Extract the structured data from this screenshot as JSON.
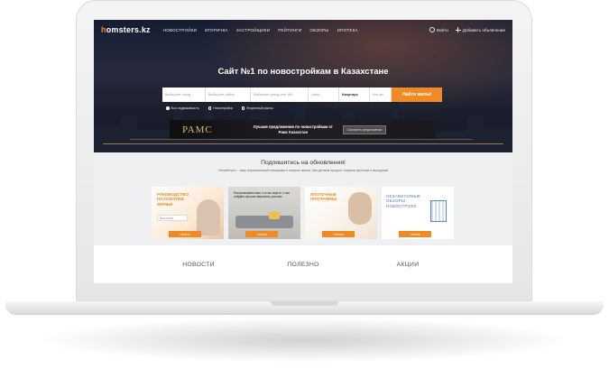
{
  "nav": {
    "logo_prefix": "h",
    "logo_rest": "omsters.kz",
    "items": [
      "НОВОСТРОЙКИ",
      "ВТОРИЧКА",
      "ЗАСТРОЙЩИКИ",
      "РЕЙТИНГИ",
      "ОБЗОРЫ",
      "ИПОТЕКА"
    ],
    "login": "Войти",
    "add_listing": "Добавить объявление"
  },
  "hero": {
    "title": "Сайт №1 по новостройкам в Казахстане"
  },
  "search": {
    "fields": [
      "Выберите город",
      "Выберите район",
      "Выберите улицу или ЖК",
      "Цена",
      "Квартира",
      "Кол-во"
    ],
    "button": "Найти жильё"
  },
  "radios": [
    "Вся недвижимость",
    "Новостройки",
    "Вторичный рынок"
  ],
  "promo": {
    "brand": "РАМС",
    "text": "Лучшие предложения по новостройкам от Рамс Казахстан",
    "button": "Смотреть предложения"
  },
  "subscribe": {
    "title": "Подпишитесь на обновления!",
    "description": "Homsters.kz – ваш персональный помощник в покупке жилья. Мы делаем процесс покупки простым и выгодным",
    "cards": [
      {
        "title": "РУКОВОДСТВО ПО ПОКУПКЕ ЖИЛЬЯ",
        "input_placeholder": "Ваш email",
        "button": "Читать"
      },
      {
        "title": "Рассказываем вам, что вы ищете, и мы найдём лучшие варианты для вас",
        "button": "Читать"
      },
      {
        "title": "ИПОТЕЧНЫЕ ПРОГРАММЫ",
        "button": "Читать"
      },
      {
        "title": "НЕЗАВИСИМЫЕ ОБЗОРЫ НОВОСТРОЕК",
        "button": "Читать"
      }
    ]
  },
  "tabs": [
    "НОВОСТИ",
    "ПОЛЕЗНО",
    "АКЦИИ"
  ],
  "colors": {
    "accent": "#f08a24"
  }
}
